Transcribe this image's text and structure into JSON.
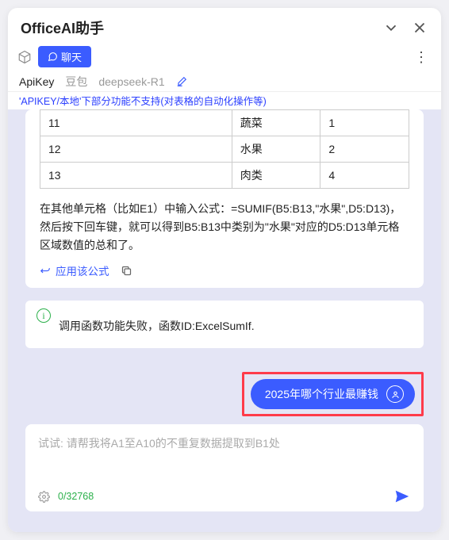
{
  "header": {
    "title": "OfficeAI助手"
  },
  "subheader": {
    "chat_tab": "聊天"
  },
  "api_tabs": {
    "apikey": "ApiKey",
    "doubao": "豆包",
    "deepseek": "deepseek-R1"
  },
  "warning": "'APIKEY/本地'下部分功能不支持(对表格的自动化操作等)",
  "assistant": {
    "table": {
      "rows": [
        {
          "c0": "11",
          "c1": "蔬菜",
          "c2": "1"
        },
        {
          "c0": "12",
          "c1": "水果",
          "c2": "2"
        },
        {
          "c0": "13",
          "c1": "肉类",
          "c2": "4"
        }
      ]
    },
    "explanation": "在其他单元格（比如E1）中输入公式：=SUMIF(B5:B13,\"水果\",D5:D13)，然后按下回车键，就可以得到B5:B13中类别为\"水果\"对应的D5:D13单元格区域数值的总和了。",
    "apply_label": "应用该公式"
  },
  "error": {
    "text": "调用函数功能失败，函数ID:ExcelSumIf."
  },
  "user_message": "2025年哪个行业最赚钱",
  "input": {
    "placeholder": "试试: 请帮我将A1至A10的不重复数据提取到B1处",
    "counter": "0/32768"
  }
}
